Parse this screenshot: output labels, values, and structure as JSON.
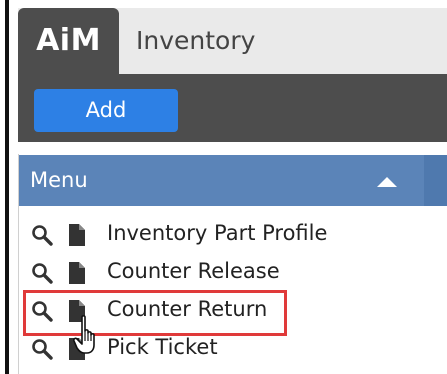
{
  "header": {
    "logo_text": "AiM",
    "module_title": "Inventory"
  },
  "toolbar": {
    "add_label": "Add"
  },
  "menu": {
    "title": "Menu",
    "items": [
      {
        "label": "Inventory Part Profile"
      },
      {
        "label": "Counter Release"
      },
      {
        "label": "Counter Return"
      },
      {
        "label": "Pick Ticket"
      }
    ]
  },
  "colors": {
    "logo_tab": "#4d4d4d",
    "toolbar": "#4d4d4d",
    "add_button": "#2d80e5",
    "menu_header": "#5b84b8",
    "highlight": "#e03a3a"
  },
  "icons": [
    "search-icon",
    "document-icon",
    "pointer-hand-icon",
    "collapse-arrow-icon"
  ]
}
